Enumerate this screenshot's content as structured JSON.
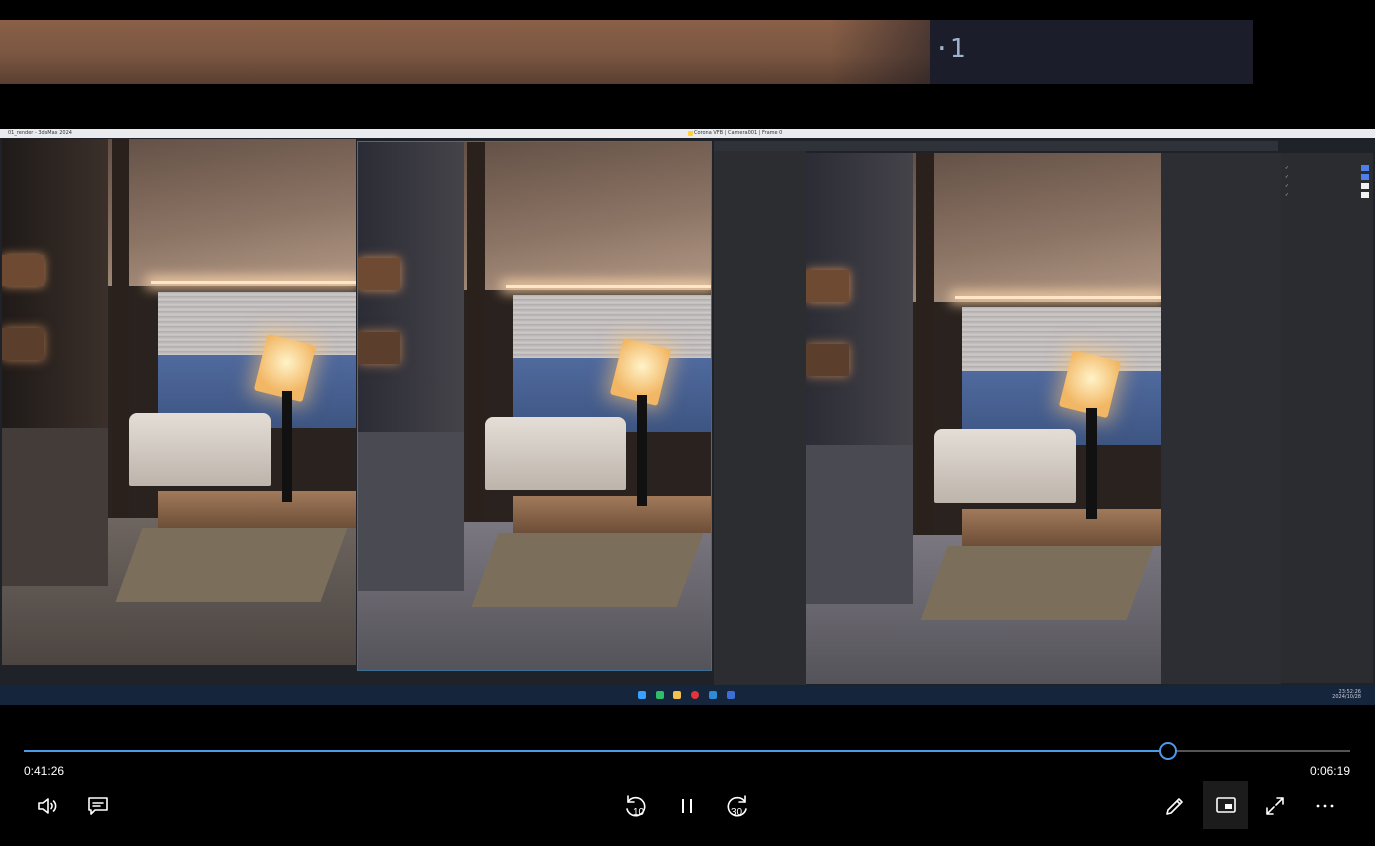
{
  "player": {
    "elapsed": "0:41:26",
    "remaining": "0:06:19",
    "progress_fraction": 0.862,
    "accent_color": "#4c9be8",
    "rewind_label": "10",
    "forward_label": "30"
  },
  "controls": {
    "left": [
      "volume-icon",
      "captions-icon"
    ],
    "center": [
      "rewind-10-icon",
      "pause-icon",
      "forward-30-icon"
    ],
    "right": [
      "pen-icon",
      "mini-player-icon",
      "fullscreen-icon",
      "more-icon"
    ]
  },
  "video_frame": {
    "left_window_title": "01_render - 3dsMax 2024",
    "right_window_title": "Corona VFB | Camera001 | Frame 0",
    "taskbar_time": "23:52:26",
    "taskbar_date": "2024/10/28"
  }
}
